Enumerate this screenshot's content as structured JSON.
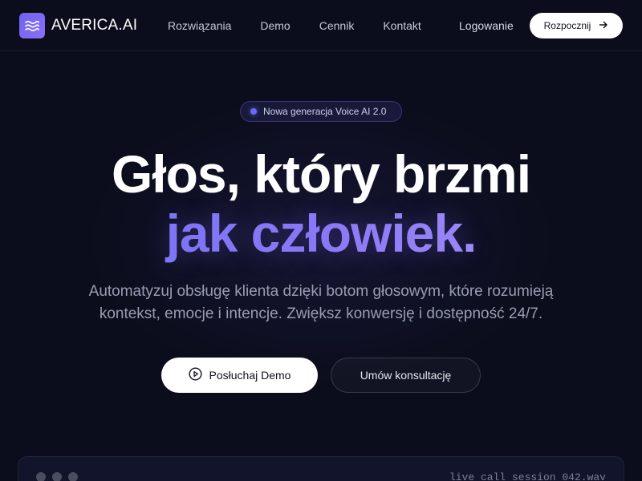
{
  "navbar": {
    "brand": "AVERICA.AI",
    "links": [
      "Rozwiązania",
      "Demo",
      "Cennik",
      "Kontakt"
    ],
    "login_label": "Logowanie",
    "start_label": "Rozpocznij"
  },
  "hero": {
    "badge_text": "Nowa generacja Voice AI 2.0",
    "headline_line1": "Głos, który brzmi",
    "headline_line2": "jak człowiek.",
    "subtitle_line1": "Automatyzuj obsługę klienta dzięki botom głosowym, które rozumieją",
    "subtitle_line2": "kontekst, emocje i intencje. Zwiększ konwersję i dostępność 24/7.",
    "demo_button_label": "Posłuchaj Demo",
    "consult_button_label": "Umów konsultację"
  },
  "session": {
    "label": "live call session 042.wav"
  },
  "icons": {
    "logo": "waves-icon",
    "start_button": "arrow-right-icon",
    "demo_button": "play-circle-icon"
  },
  "colors": {
    "background": "#0b0d1c",
    "accent": "#7b6ff5",
    "primary_button": "#ffffff"
  }
}
